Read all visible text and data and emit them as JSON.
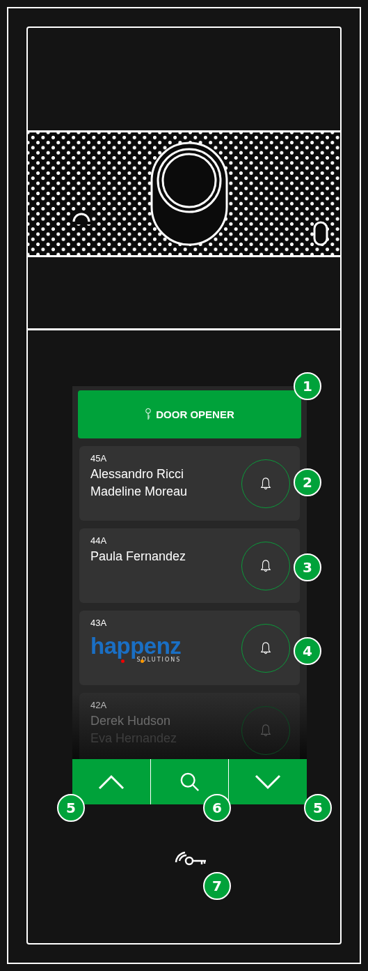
{
  "door_opener": {
    "label": "DOOR OPENER"
  },
  "entries": [
    {
      "kind": "names",
      "unit": "45A",
      "names": [
        "Alessandro Ricci",
        "Madeline Moreau"
      ],
      "faded": false
    },
    {
      "kind": "names",
      "unit": "44A",
      "names": [
        "Paula Fernandez"
      ],
      "faded": false
    },
    {
      "kind": "logo",
      "unit": "43A",
      "logo_text": "happenz",
      "logo_subtext": "SOLUTIONS",
      "faded": false
    },
    {
      "kind": "names",
      "unit": "42A",
      "names": [
        "Derek Hudson",
        "Eva Hernandez"
      ],
      "faded": true
    }
  ],
  "callouts": [
    "1",
    "2",
    "3",
    "4",
    "5",
    "6",
    "5",
    "7"
  ]
}
